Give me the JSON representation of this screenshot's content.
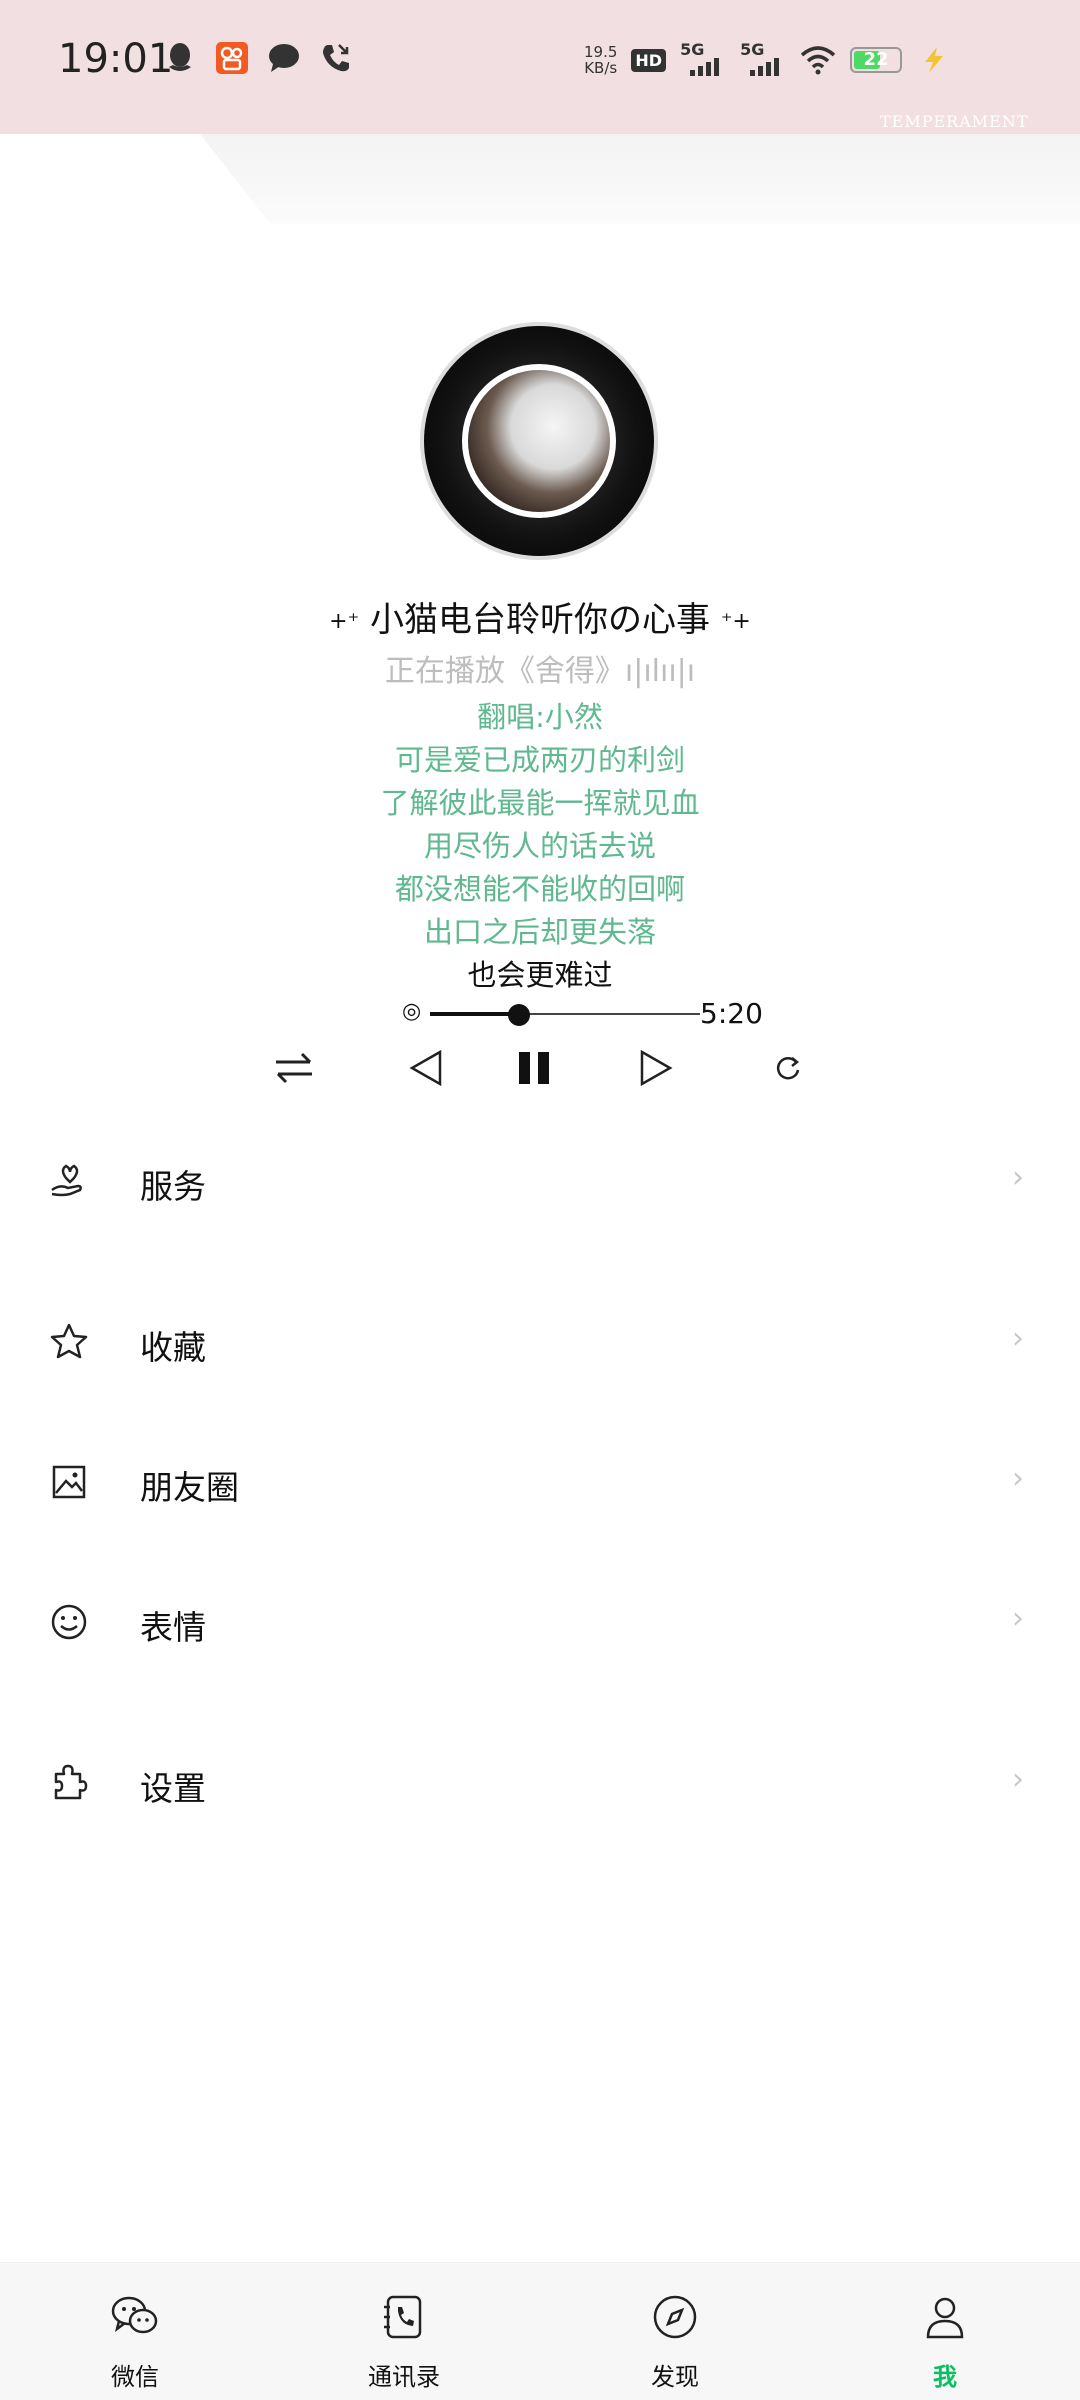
{
  "status_bar": {
    "time": "19:01",
    "net_speed_value": "19.5",
    "net_speed_unit": "KB/s",
    "hd_label": "HD",
    "sim1_label": "5G",
    "sim2_label": "5G",
    "battery": "22",
    "watermark": "TEMPERAMENT"
  },
  "player": {
    "title": "小猫电台聆听你の心事",
    "now_playing": "正在播放《舍得》ı|ılıı|ı",
    "lyrics": [
      "翻唱:小然",
      "可是爱已成两刃的利剑",
      "了解彼此最能一挥就见血",
      "用尽伤人的话去说",
      "都没想能不能收的回啊",
      "出口之后却更失落"
    ],
    "current_lyric": "也会更难过",
    "progress_fraction": 0.33,
    "duration": "5:20"
  },
  "menu": [
    {
      "label": "服务",
      "icon": "service-icon"
    },
    {
      "label": "收藏",
      "icon": "star-icon"
    },
    {
      "label": "朋友圈",
      "icon": "image-icon"
    },
    {
      "label": "表情",
      "icon": "smile-icon"
    },
    {
      "label": "设置",
      "icon": "puzzle-icon"
    }
  ],
  "bottom_nav": [
    {
      "label": "微信",
      "icon": "chat-icon"
    },
    {
      "label": "通讯录",
      "icon": "contacts-icon"
    },
    {
      "label": "发现",
      "icon": "compass-icon"
    },
    {
      "label": "我",
      "icon": "me-icon",
      "active": true
    }
  ],
  "colors": {
    "accent_green": "#07c160",
    "lyric_green": "#5fb88f",
    "status_pink": "#f2dfe2"
  }
}
